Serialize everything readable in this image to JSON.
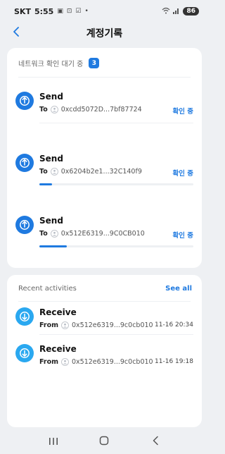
{
  "status_bar": {
    "carrier": "SKT",
    "time": "5:55",
    "dot": "•",
    "battery": "86"
  },
  "header": {
    "title": "계정기록"
  },
  "pending": {
    "label": "네트워크 확인 대기 중",
    "count": "3",
    "transactions": [
      {
        "type": "Send",
        "direction": "To",
        "address": "0xcdd5072D...7bf87724",
        "status": "확인 중",
        "progress": 0.0
      },
      {
        "type": "Send",
        "direction": "To",
        "address": "0x6204b2e1...32C140f9",
        "status": "확인 중",
        "progress": 0.08
      },
      {
        "type": "Send",
        "direction": "To",
        "address": "0x512E6319...9C0CB010",
        "status": "확인 중",
        "progress": 0.18
      }
    ]
  },
  "recent": {
    "label": "Recent activities",
    "see_all": "See all",
    "items": [
      {
        "type": "Receive",
        "direction": "From",
        "address": "0x512e6319...9c0cb010",
        "time": "11-16 20:34"
      },
      {
        "type": "Receive",
        "direction": "From",
        "address": "0x512e6319...9c0cb010",
        "time": "11-16 19:18"
      }
    ]
  },
  "colors": {
    "accent": "#1f7ae0",
    "receive_icon": "#2aa8f0",
    "background": "#eef0f3"
  }
}
